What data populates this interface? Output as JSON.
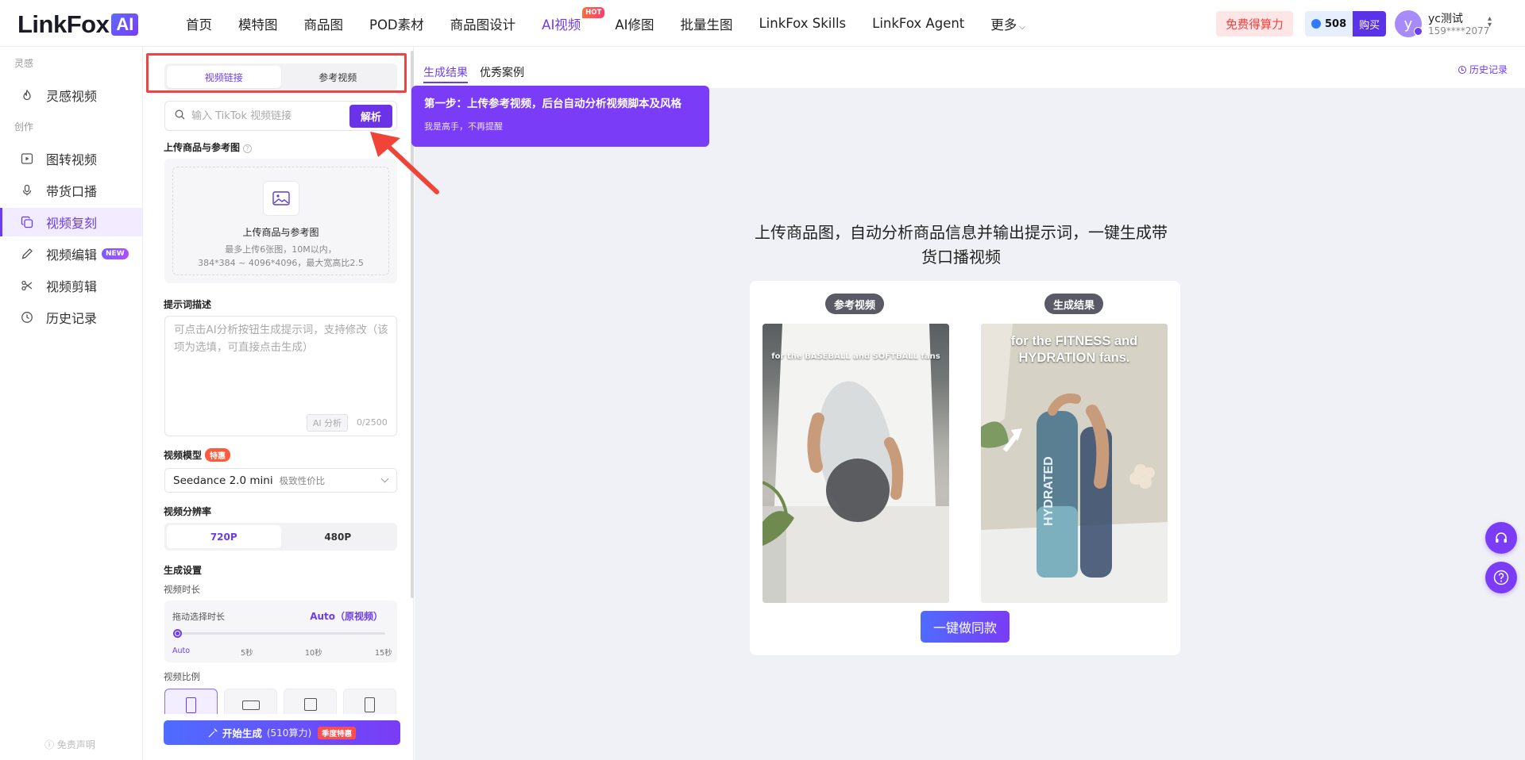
{
  "header": {
    "logo_text": "LinkFox",
    "logo_badge": "AI",
    "nav": [
      {
        "label": "首页"
      },
      {
        "label": "模特图"
      },
      {
        "label": "商品图"
      },
      {
        "label": "POD素材"
      },
      {
        "label": "商品图设计"
      },
      {
        "label": "AI视频",
        "badge": "HOT",
        "active": true
      },
      {
        "label": "AI修图"
      },
      {
        "label": "批量生图"
      },
      {
        "label": "LinkFox Skills"
      },
      {
        "label": "LinkFox Agent"
      },
      {
        "label": "更多"
      }
    ],
    "free_label": "免费得算力",
    "credits": "508",
    "buy_label": "购买",
    "avatar_letter": "y",
    "user_name": "yc测试",
    "user_phone": "159****2077"
  },
  "sidebar": {
    "section_inspiration": "灵感",
    "section_create": "创作",
    "items": [
      {
        "label": "灵感视频",
        "icon": "flame-icon"
      },
      {
        "label": "图转视频",
        "icon": "play-square-icon"
      },
      {
        "label": "带货口播",
        "icon": "microphone-icon"
      },
      {
        "label": "视频复刻",
        "icon": "copy-icon",
        "active": true
      },
      {
        "label": "视频编辑",
        "icon": "pencil-icon",
        "badge": "NEW"
      },
      {
        "label": "视频剪辑",
        "icon": "scissors-icon"
      },
      {
        "label": "历史记录",
        "icon": "clock-icon"
      }
    ],
    "disclaimer": "免责声明"
  },
  "config": {
    "source_tabs": [
      "视频链接",
      "参考视频"
    ],
    "url_placeholder": "输入 TikTok 视频链接",
    "parse_label": "解析",
    "upload_label": "上传商品与参考图",
    "upload_title": "上传商品与参考图",
    "upload_hint_1": "最多上传6张图，10M以内，",
    "upload_hint_2": "384*384 ~ 4096*4096，最大宽高比2.5",
    "prompt_label": "提示词描述",
    "prompt_placeholder": "可点击AI分析按钮生成提示词，支持修改（该项为选填，可直接点击生成）",
    "ai_analyze_label": "AI 分析",
    "char_count": "0/2500",
    "model_label": "视频模型",
    "model_badge": "特惠",
    "model_name": "Seedance 2.0 mini",
    "model_desc": "极致性价比",
    "resolution_label": "视频分辨率",
    "resolutions": [
      "720P",
      "480P"
    ],
    "gen_settings_label": "生成设置",
    "duration_label": "视频时长",
    "duration_drag_label": "拖动选择时长",
    "duration_value": "Auto（原视频）",
    "duration_ticks": [
      "Auto",
      "5秒",
      "10秒",
      "15秒"
    ],
    "ratio_label": "视频比例",
    "generate_label": "开始生成",
    "generate_cost": "(510算力)",
    "generate_badge": "季度特惠"
  },
  "main": {
    "tabs": [
      "生成结果",
      "优秀案例"
    ],
    "history_label": "历史记录",
    "tooltip_title": "第一步：上传参考视频，后台自动分析视频脚本及风格",
    "tooltip_dismiss": "我是高手，不再提醒",
    "headline_1": "上传商品图，自动分析商品信息并输出提示词，一键生成带",
    "headline_2": "货口播视频",
    "ref_pill": "参考视频",
    "result_pill": "生成结果",
    "ref_caption": "for the BASEBALL and SOFTBALL fans",
    "result_caption_1": "for the FITNESS and",
    "result_caption_2": "HYDRATION fans.",
    "bottle_text": "HYDRATED",
    "make_same_label": "一键做同款"
  }
}
